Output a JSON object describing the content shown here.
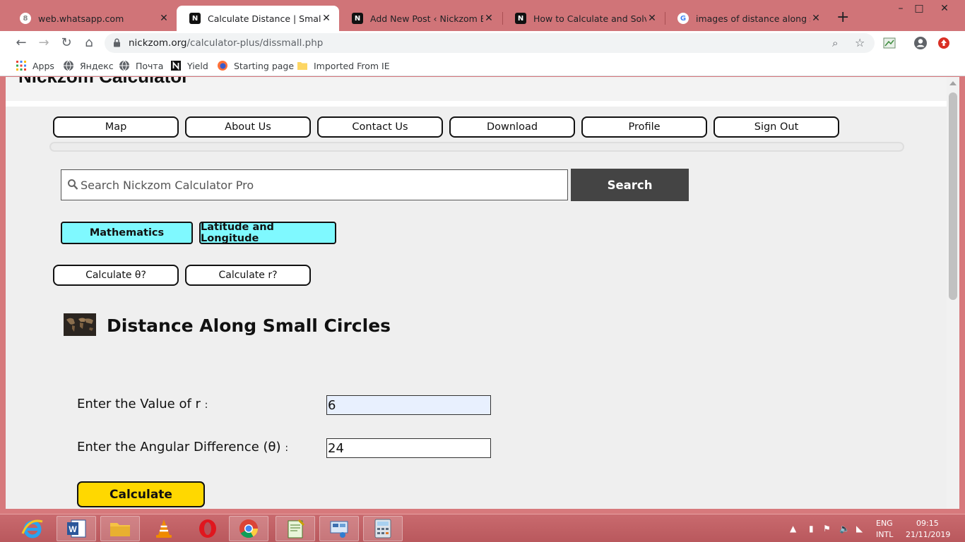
{
  "browser": {
    "tabs": [
      {
        "title": "web.whatsapp.com",
        "favicon": "whatsapp-icon",
        "active": false
      },
      {
        "title": "Calculate Distance | Small Circle",
        "favicon": "nickzom-icon",
        "active": true
      },
      {
        "title": "Add New Post ‹ Nickzom Blog —",
        "favicon": "nickzom-icon",
        "active": false
      },
      {
        "title": "How to Calculate and Solve for",
        "favicon": "nickzom-icon",
        "active": false
      },
      {
        "title": "images of distance along small",
        "favicon": "google-icon",
        "active": false
      }
    ],
    "close_glyph": "✕",
    "new_tab_glyph": "+",
    "url_host": "nickzom.org",
    "url_path": "/calculator-plus/dissmall.php",
    "bookmarks": [
      {
        "label": "Apps",
        "icon": "apps-grid-icon"
      },
      {
        "label": "Яндекс",
        "icon": "globe-icon"
      },
      {
        "label": "Почта",
        "icon": "globe-icon"
      },
      {
        "label": "Yield",
        "icon": "notion-icon"
      },
      {
        "label": "Starting page",
        "icon": "firefox-icon"
      },
      {
        "label": "Imported From IE",
        "icon": "folder-icon"
      }
    ]
  },
  "site": {
    "logo_text": "Nickzom Calculator",
    "nav": [
      "Map",
      "About Us",
      "Contact Us",
      "Download",
      "Profile",
      "Sign Out"
    ],
    "search_placeholder": "Search Nickzom Calculator Pro",
    "search_button": "Search",
    "categories": [
      "Mathematics",
      "Latitude and Longitude"
    ],
    "sub_links": [
      "Calculate θ?",
      "Calculate r?"
    ],
    "page_title": "Distance Along Small Circles",
    "fields": [
      {
        "label": "Enter the Value of r",
        "value": "6"
      },
      {
        "label": "Enter the Angular Difference (θ)",
        "value": "24"
      }
    ],
    "field_colon": ":",
    "calculate_button": "Calculate"
  },
  "taskbar": {
    "lang_top": "ENG",
    "lang_bottom": "INTL",
    "time": "09:15",
    "date": "21/11/2019"
  },
  "colors": {
    "chrome_frame": "#d07478",
    "category_button": "#7ff9ff",
    "calculate_button": "#ffd800",
    "search_button": "#444444"
  }
}
